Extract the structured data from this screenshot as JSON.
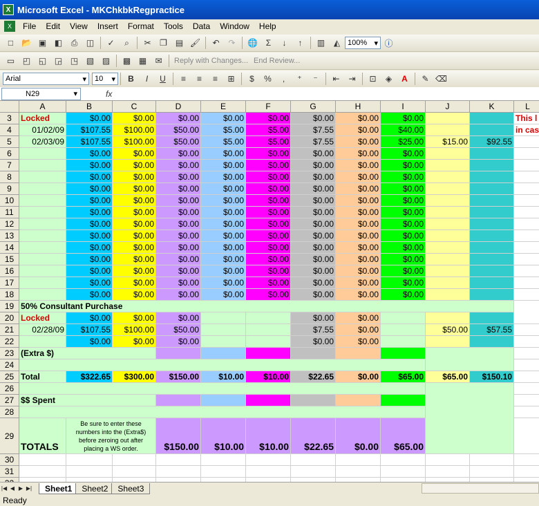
{
  "window": {
    "title": "Microsoft Excel - MKChkbkRegpractice",
    "app_icon": "excel-icon"
  },
  "menu": [
    "File",
    "Edit",
    "View",
    "Insert",
    "Format",
    "Tools",
    "Data",
    "Window",
    "Help"
  ],
  "toolbar": {
    "zoom": "100%",
    "autosum": "Σ",
    "font_name": "Arial",
    "font_size": "10",
    "reply_label": "Reply with Changes...",
    "end_review_label": "End Review..."
  },
  "formula_bar": {
    "name_box": "N29",
    "fx": "fx",
    "content": ""
  },
  "columns": [
    "A",
    "B",
    "C",
    "D",
    "E",
    "F",
    "G",
    "H",
    "I",
    "J",
    "K",
    "L"
  ],
  "colors": {
    "B": "#00ccff",
    "C": "#ffff00",
    "D": "#cc99ff",
    "E": "#99ccff",
    "F": "#ff00ff",
    "G": "#c0c0c0",
    "H": "#ffcc99",
    "I": "#00ff00",
    "J": "#ffff99",
    "K": "#33cccc",
    "green": "#ccffcc",
    "red": "#dd0000"
  },
  "rows": [
    {
      "n": "3",
      "A": "Locked",
      "B": "$0.00",
      "C": "$0.00",
      "D": "$0.00",
      "E": "$0.00",
      "F": "$0.00",
      "G": "$0.00",
      "H": "$0.00",
      "I": "$0.00",
      "J": "",
      "K": "",
      "L": "This l"
    },
    {
      "n": "4",
      "A": "01/02/09",
      "B": "$107.55",
      "C": "$100.00",
      "D": "$50.00",
      "E": "$5.00",
      "F": "$5.00",
      "G": "$7.55",
      "H": "$0.00",
      "I": "$40.00",
      "J": "",
      "K": "",
      "L": "in cas"
    },
    {
      "n": "5",
      "A": "02/03/09",
      "B": "$107.55",
      "C": "$100.00",
      "D": "$50.00",
      "E": "$5.00",
      "F": "$5.00",
      "G": "$7.55",
      "H": "$0.00",
      "I": "$25.00",
      "J": "$15.00",
      "K": "$92.55",
      "L": ""
    },
    {
      "n": "6",
      "A": "",
      "B": "$0.00",
      "C": "$0.00",
      "D": "$0.00",
      "E": "$0.00",
      "F": "$0.00",
      "G": "$0.00",
      "H": "$0.00",
      "I": "$0.00",
      "J": "",
      "K": "",
      "L": ""
    },
    {
      "n": "7",
      "A": "",
      "B": "$0.00",
      "C": "$0.00",
      "D": "$0.00",
      "E": "$0.00",
      "F": "$0.00",
      "G": "$0.00",
      "H": "$0.00",
      "I": "$0.00",
      "J": "",
      "K": "",
      "L": ""
    },
    {
      "n": "8",
      "A": "",
      "B": "$0.00",
      "C": "$0.00",
      "D": "$0.00",
      "E": "$0.00",
      "F": "$0.00",
      "G": "$0.00",
      "H": "$0.00",
      "I": "$0.00",
      "J": "",
      "K": "",
      "L": ""
    },
    {
      "n": "9",
      "A": "",
      "B": "$0.00",
      "C": "$0.00",
      "D": "$0.00",
      "E": "$0.00",
      "F": "$0.00",
      "G": "$0.00",
      "H": "$0.00",
      "I": "$0.00",
      "J": "",
      "K": "",
      "L": ""
    },
    {
      "n": "10",
      "A": "",
      "B": "$0.00",
      "C": "$0.00",
      "D": "$0.00",
      "E": "$0.00",
      "F": "$0.00",
      "G": "$0.00",
      "H": "$0.00",
      "I": "$0.00",
      "J": "",
      "K": "",
      "L": ""
    },
    {
      "n": "11",
      "A": "",
      "B": "$0.00",
      "C": "$0.00",
      "D": "$0.00",
      "E": "$0.00",
      "F": "$0.00",
      "G": "$0.00",
      "H": "$0.00",
      "I": "$0.00",
      "J": "",
      "K": "",
      "L": ""
    },
    {
      "n": "12",
      "A": "",
      "B": "$0.00",
      "C": "$0.00",
      "D": "$0.00",
      "E": "$0.00",
      "F": "$0.00",
      "G": "$0.00",
      "H": "$0.00",
      "I": "$0.00",
      "J": "",
      "K": "",
      "L": ""
    },
    {
      "n": "13",
      "A": "",
      "B": "$0.00",
      "C": "$0.00",
      "D": "$0.00",
      "E": "$0.00",
      "F": "$0.00",
      "G": "$0.00",
      "H": "$0.00",
      "I": "$0.00",
      "J": "",
      "K": "",
      "L": ""
    },
    {
      "n": "14",
      "A": "",
      "B": "$0.00",
      "C": "$0.00",
      "D": "$0.00",
      "E": "$0.00",
      "F": "$0.00",
      "G": "$0.00",
      "H": "$0.00",
      "I": "$0.00",
      "J": "",
      "K": "",
      "L": ""
    },
    {
      "n": "15",
      "A": "",
      "B": "$0.00",
      "C": "$0.00",
      "D": "$0.00",
      "E": "$0.00",
      "F": "$0.00",
      "G": "$0.00",
      "H": "$0.00",
      "I": "$0.00",
      "J": "",
      "K": "",
      "L": ""
    },
    {
      "n": "16",
      "A": "",
      "B": "$0.00",
      "C": "$0.00",
      "D": "$0.00",
      "E": "$0.00",
      "F": "$0.00",
      "G": "$0.00",
      "H": "$0.00",
      "I": "$0.00",
      "J": "",
      "K": "",
      "L": ""
    },
    {
      "n": "17",
      "A": "",
      "B": "$0.00",
      "C": "$0.00",
      "D": "$0.00",
      "E": "$0.00",
      "F": "$0.00",
      "G": "$0.00",
      "H": "$0.00",
      "I": "$0.00",
      "J": "",
      "K": "",
      "L": ""
    },
    {
      "n": "18",
      "A": "",
      "B": "$0.00",
      "C": "$0.00",
      "D": "$0.00",
      "E": "$0.00",
      "F": "$0.00",
      "G": "$0.00",
      "H": "$0.00",
      "I": "$0.00",
      "J": "",
      "K": "",
      "L": ""
    }
  ],
  "lower": {
    "r19": "50% Consultant Purchase",
    "r20": {
      "A": "Locked",
      "B": "$0.00",
      "C": "$0.00",
      "D": "$0.00",
      "G": "$0.00",
      "H": "$0.00"
    },
    "r21": {
      "A": "02/28/09",
      "B": "$107.55",
      "C": "$100.00",
      "D": "$50.00",
      "G": "$7.55",
      "H": "$0.00",
      "J": "$50.00",
      "K": "$57.55"
    },
    "r22": {
      "B": "$0.00",
      "C": "$0.00",
      "D": "$0.00",
      "G": "$0.00",
      "H": "$0.00"
    },
    "r23": "(Extra $)",
    "r25": {
      "A": "Total",
      "B": "$322.65",
      "C": "$300.00",
      "D": "$150.00",
      "E": "$10.00",
      "F": "$10.00",
      "G": "$22.65",
      "H": "$0.00",
      "I": "$65.00",
      "J": "$65.00",
      "K": "$150.10"
    },
    "r27": "$$ Spent",
    "r29": {
      "A": "TOTALS",
      "note": "Be sure to enter these numbers into the (Extra$) before zeroing out after placing a WS order.",
      "D": "$150.00",
      "E": "$10.00",
      "F": "$10.00",
      "G": "$22.65",
      "H": "$0.00",
      "I": "$65.00"
    }
  },
  "row_numbers_tail": [
    "30",
    "31",
    "32"
  ],
  "sheets": [
    "Sheet1",
    "Sheet2",
    "Sheet3"
  ],
  "status": "Ready"
}
